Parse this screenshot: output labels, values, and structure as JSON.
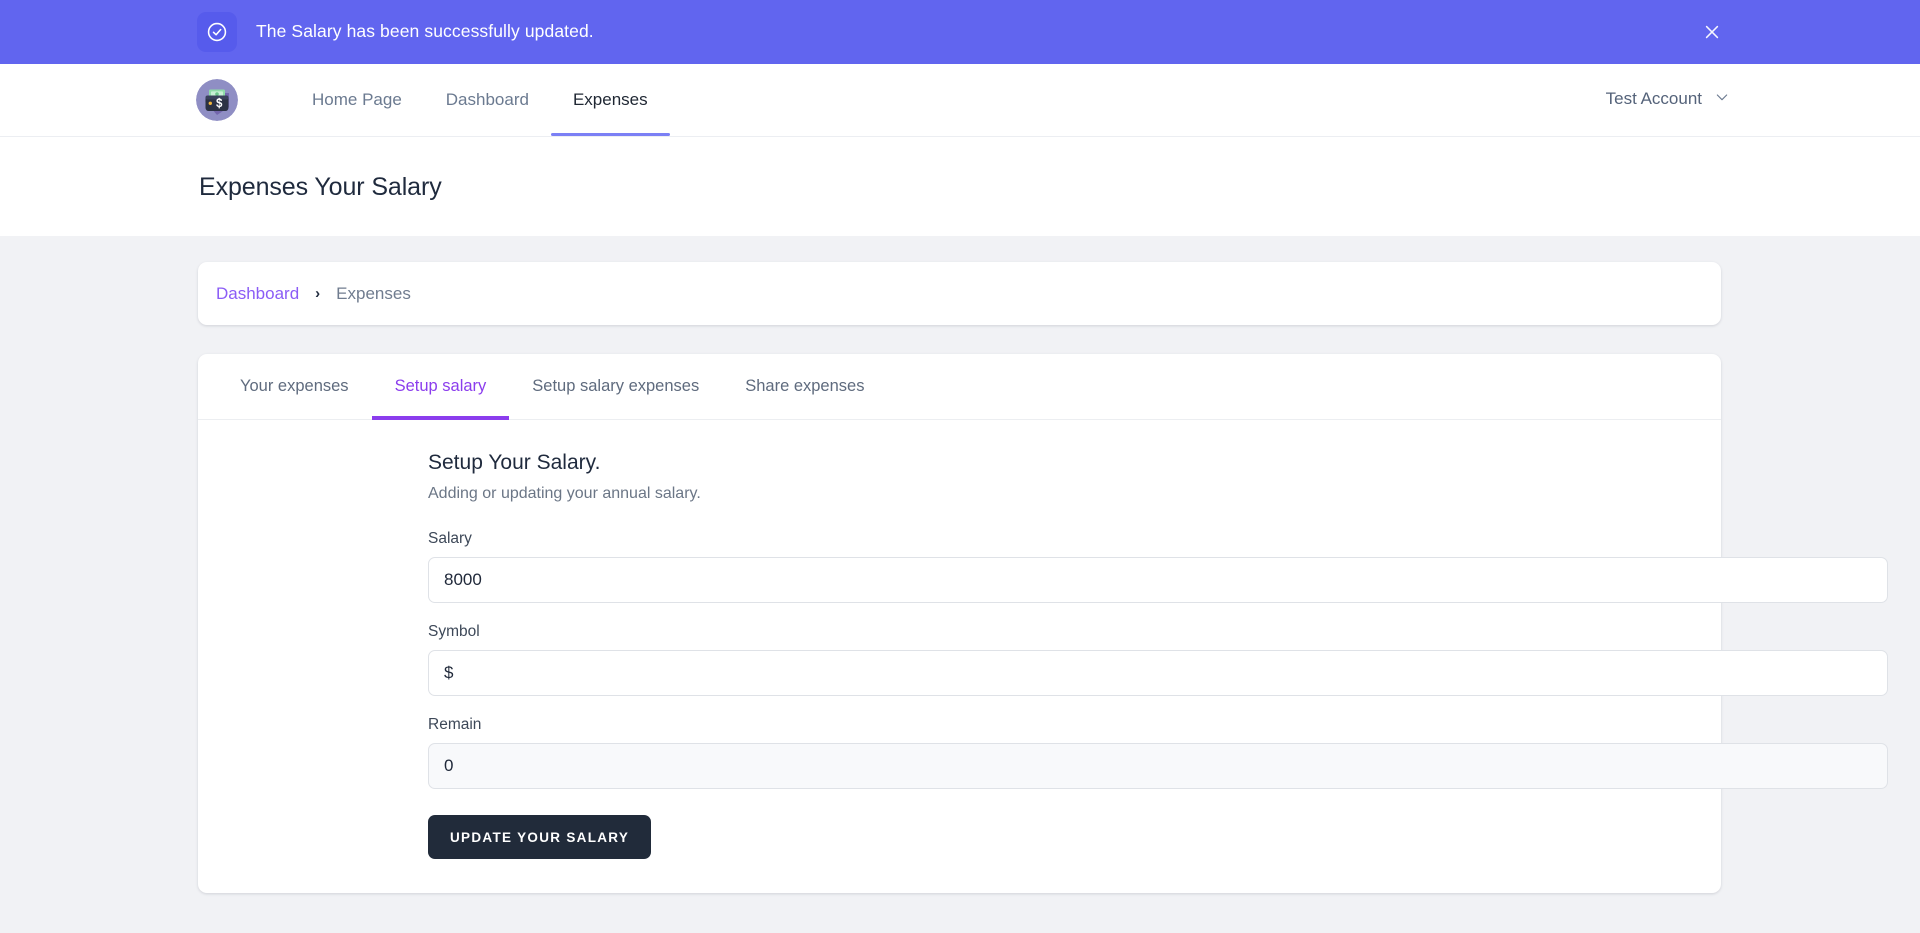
{
  "notification": {
    "message": "The Salary has been successfully updated.",
    "icon": "check-circle-icon",
    "close_icon": "close-icon",
    "background_color": "#6165ef",
    "icon_box_color": "#565bec"
  },
  "topnav": {
    "logo_icon": "money-wallet-logo-icon",
    "links": [
      {
        "label": "Home Page",
        "active": false
      },
      {
        "label": "Dashboard",
        "active": false
      },
      {
        "label": "Expenses",
        "active": true
      }
    ],
    "account": {
      "label": "Test Account",
      "chevron_icon": "chevron-down-icon"
    },
    "active_underline_color": "#7b80f5"
  },
  "page": {
    "title": "Expenses Your Salary"
  },
  "breadcrumb": {
    "items": [
      {
        "label": "Dashboard",
        "current": false
      },
      {
        "label": "Expenses",
        "current": true
      }
    ],
    "separator": "›",
    "link_color": "#8b5cf6"
  },
  "tabs": [
    {
      "label": "Your expenses",
      "active": false
    },
    {
      "label": "Setup salary",
      "active": true
    },
    {
      "label": "Setup salary expenses",
      "active": false
    },
    {
      "label": "Share expenses",
      "active": false
    }
  ],
  "tabs_active_color": "#8b3ded",
  "form": {
    "heading": "Setup Your Salary.",
    "subtitle": "Adding or updating your annual salary.",
    "fields": [
      {
        "label": "Salary",
        "value": "8000",
        "readonly": false
      },
      {
        "label": "Symbol",
        "value": "$",
        "readonly": false
      },
      {
        "label": "Remain",
        "value": "0",
        "readonly": true
      }
    ],
    "submit_label": "UPDATE YOUR SALARY",
    "submit_color": "#212b3a"
  }
}
